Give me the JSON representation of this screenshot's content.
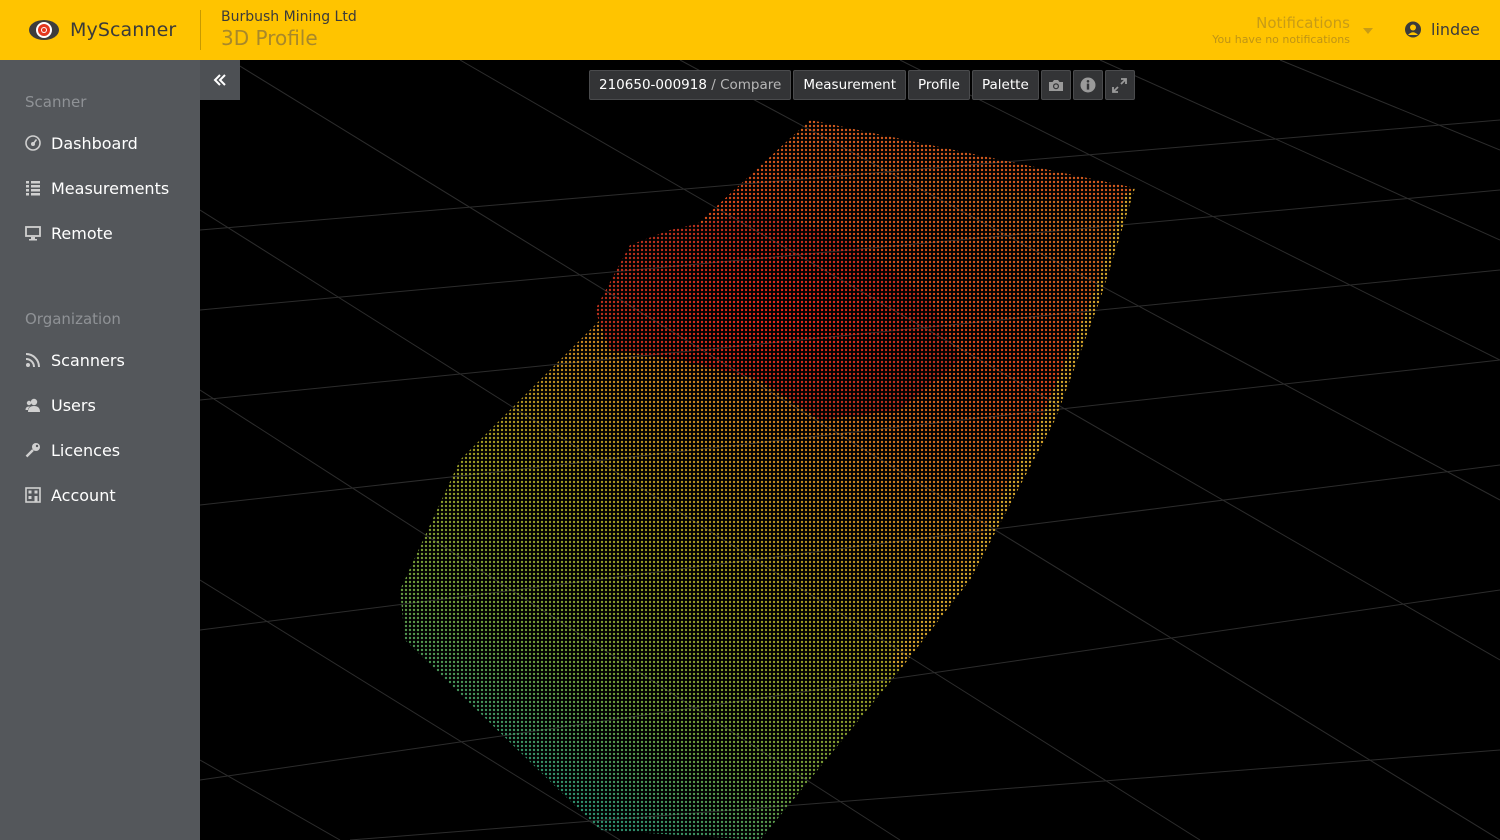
{
  "header": {
    "brand": "MyScanner",
    "org_name": "Burbush Mining Ltd",
    "page_title": "3D Profile",
    "notifications_title": "Notifications",
    "notifications_sub": "You have no notifications",
    "username": "lindee"
  },
  "sidebar": {
    "sections": [
      {
        "title": "Scanner",
        "items": [
          {
            "label": "Dashboard",
            "icon": "dashboard-icon"
          },
          {
            "label": "Measurements",
            "icon": "list-icon"
          },
          {
            "label": "Remote",
            "icon": "monitor-icon"
          }
        ]
      },
      {
        "title": "Organization",
        "items": [
          {
            "label": "Scanners",
            "icon": "rss-icon"
          },
          {
            "label": "Users",
            "icon": "users-icon"
          },
          {
            "label": "Licences",
            "icon": "key-icon"
          },
          {
            "label": "Account",
            "icon": "building-icon"
          }
        ]
      }
    ]
  },
  "toolbar": {
    "measurement_id": "210650-000918",
    "compare_label": "/ Compare",
    "measurement_label": "Measurement",
    "profile_label": "Profile",
    "palette_label": "Palette",
    "icons": [
      "camera-icon",
      "info-icon",
      "expand-icon"
    ]
  },
  "colors": {
    "header_bg": "#ffc400",
    "sidebar_bg": "#54575b",
    "viewport_bg": "#000000",
    "toolbar_btn_bg": "#333436"
  }
}
